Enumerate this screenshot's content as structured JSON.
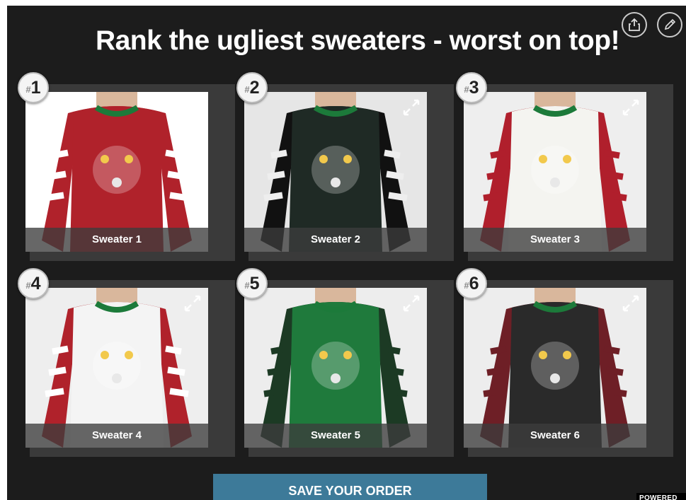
{
  "title": "Rank the ugliest sweaters - worst on top!",
  "toolbar": {
    "share_icon": "share-icon",
    "edit_icon": "pencil-icon"
  },
  "items": [
    {
      "rank_hash": "#",
      "rank": "1",
      "caption": "Sweater 1",
      "body": "#b0222b",
      "sleeve_a": "#b0222b",
      "sleeve_b": "#ffffff",
      "bg": "#ffffff"
    },
    {
      "rank_hash": "#",
      "rank": "2",
      "caption": "Sweater 2",
      "body": "#1f2a25",
      "sleeve_a": "#111111",
      "sleeve_b": "#eeeeee",
      "bg": "#e6e6e6"
    },
    {
      "rank_hash": "#",
      "rank": "3",
      "caption": "Sweater 3",
      "body": "#f4f4f0",
      "sleeve_a": "#b01f2c",
      "sleeve_b": "#b01f2c",
      "bg": "#eeeeee"
    },
    {
      "rank_hash": "#",
      "rank": "4",
      "caption": "Sweater 4",
      "body": "#f4f4f4",
      "sleeve_a": "#b0222b",
      "sleeve_b": "#ffffff",
      "bg": "#eeeeee"
    },
    {
      "rank_hash": "#",
      "rank": "5",
      "caption": "Sweater 5",
      "body": "#1f7a3c",
      "sleeve_a": "#1c3a24",
      "sleeve_b": "#1c3a24",
      "bg": "#ededed"
    },
    {
      "rank_hash": "#",
      "rank": "6",
      "caption": "Sweater 6",
      "body": "#2a2a2a",
      "sleeve_a": "#6e1f26",
      "sleeve_b": "#6e1f26",
      "bg": "#ededed"
    }
  ],
  "save_button": "SAVE YOUR ORDER",
  "powered_by": "POWERED BY"
}
